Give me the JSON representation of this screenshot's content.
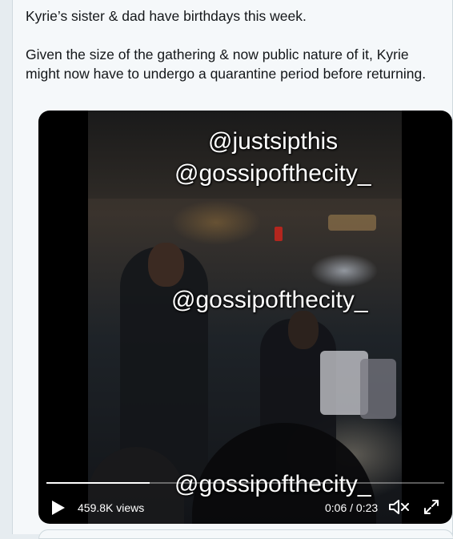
{
  "tweet": {
    "paragraph_1": "Kyrie’s sister & dad have birthdays this week.",
    "paragraph_2": "Given the size of the gathering & now public nature of it, Kyrie might now have to undergo a quarantine period before returning."
  },
  "video": {
    "watermarks": [
      "@justsipthis",
      "@gossipofthecity_",
      "@gossipofthecity_",
      "@gossipofthecity_"
    ],
    "views": "459.8K views",
    "time": "0:06 / 0:23",
    "progress_fraction": 0.26,
    "icons": {
      "play": "play-icon",
      "volume": "volume-icon",
      "fullscreen": "fullscreen-icon"
    }
  }
}
